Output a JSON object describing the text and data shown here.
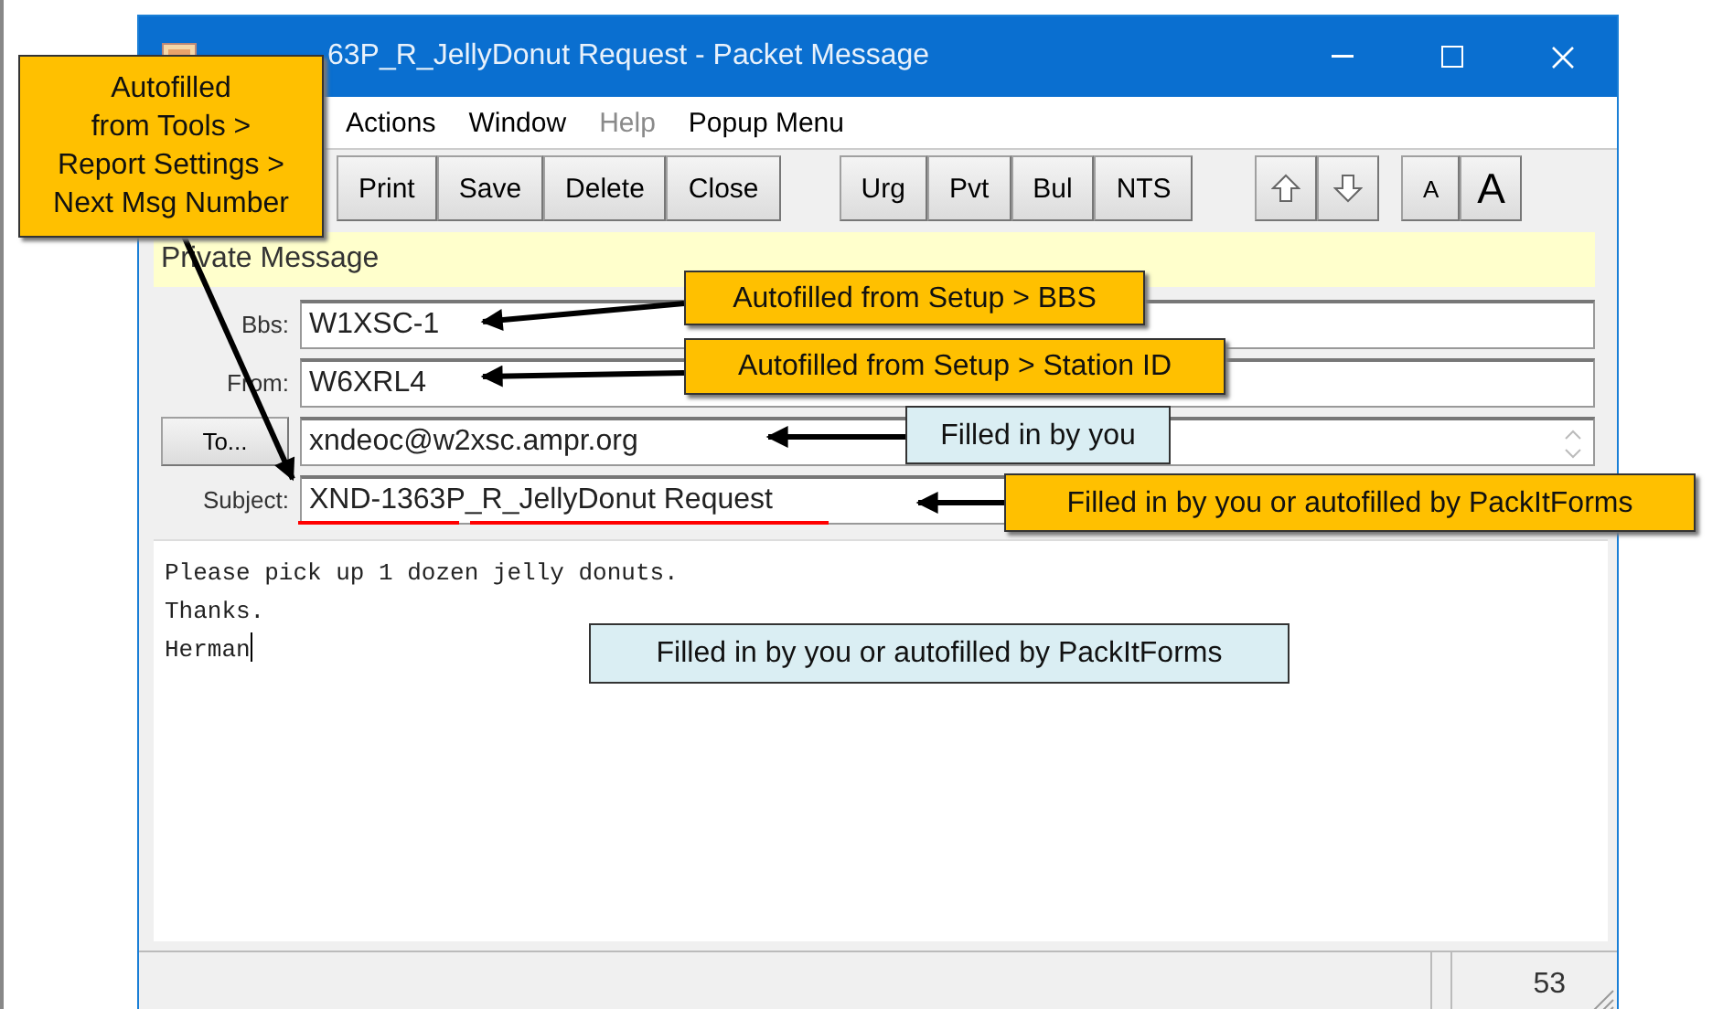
{
  "window": {
    "title": "63P_R_JellyDonut Request - Packet Message",
    "menu": [
      {
        "label": "Actions",
        "disabled": false
      },
      {
        "label": "Window",
        "disabled": false
      },
      {
        "label": "Help",
        "disabled": true
      },
      {
        "label": "Popup Menu",
        "disabled": false
      }
    ],
    "toolbar": [
      {
        "label": "Print",
        "kind": "text"
      },
      {
        "label": "Save",
        "kind": "text"
      },
      {
        "label": "Delete",
        "kind": "text"
      },
      {
        "label": "Close",
        "kind": "text"
      },
      {
        "label": "Urg",
        "kind": "text"
      },
      {
        "label": "Pvt",
        "kind": "text"
      },
      {
        "label": "Bul",
        "kind": "text"
      },
      {
        "label": "NTS",
        "kind": "text"
      },
      {
        "kind": "up"
      },
      {
        "kind": "down"
      },
      {
        "label": "A",
        "kind": "small"
      },
      {
        "label": "A",
        "kind": "large"
      }
    ],
    "banner": "Private Message",
    "fields": [
      {
        "label": "Bbs:",
        "value": "W1XSC-1",
        "kind": "label"
      },
      {
        "label": "From:",
        "value": "W6XRL4",
        "kind": "label"
      },
      {
        "label": "To...",
        "value": "xndeoc@w2xsc.ampr.org",
        "kind": "button"
      },
      {
        "label": "Subject:",
        "value": "XND-1363P_R_JellyDonut Request",
        "kind": "label"
      }
    ],
    "body": [
      "Please pick up 1 dozen jelly donuts.",
      "Thanks.",
      "Herman"
    ],
    "status": "53"
  },
  "callouts": [
    {
      "text": "Autofilled\nfrom Tools >\nReport Settings >\nNext Msg Number",
      "kind": "orange"
    },
    {
      "text": "Autofilled from Setup > BBS",
      "kind": "orange"
    },
    {
      "text": "Autofilled from Setup > Station ID",
      "kind": "orange"
    },
    {
      "text": "Filled in by you",
      "kind": "blue"
    },
    {
      "text": "Filled in by you or autofilled by PackItForms",
      "kind": "orange"
    },
    {
      "text": "Filled in by you or autofilled by PackItForms",
      "kind": "blue"
    }
  ]
}
